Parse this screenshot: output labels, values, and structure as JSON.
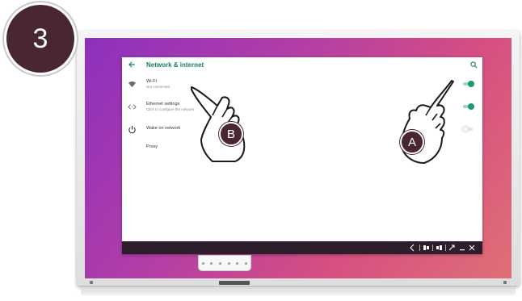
{
  "step": {
    "number": "3"
  },
  "window": {
    "title": "Network & internet"
  },
  "settings": {
    "items": [
      {
        "title": "Wi-Fi",
        "subtitle": "Not connected",
        "toggle": "on"
      },
      {
        "title": "Ethernet settings",
        "subtitle": "Click to configure the network",
        "toggle": "on"
      },
      {
        "title": "Wake on network",
        "subtitle": "",
        "toggle": "off"
      },
      {
        "title": "Proxy",
        "subtitle": "",
        "toggle": "none"
      }
    ]
  },
  "callouts": {
    "a": "A",
    "b": "B"
  },
  "colors": {
    "accent": "#1a9a76",
    "badge": "#4a2533",
    "nav_bar": "#2e1d2a",
    "wallpaper_start": "#8e30bd",
    "wallpaper_end": "#e06f76"
  },
  "icons": [
    "arrow-left-icon",
    "search-icon",
    "wifi-icon",
    "ethernet-icon",
    "power-icon",
    "back-nav-icon",
    "window-layout-icon",
    "minimize-icon",
    "close-icon"
  ]
}
